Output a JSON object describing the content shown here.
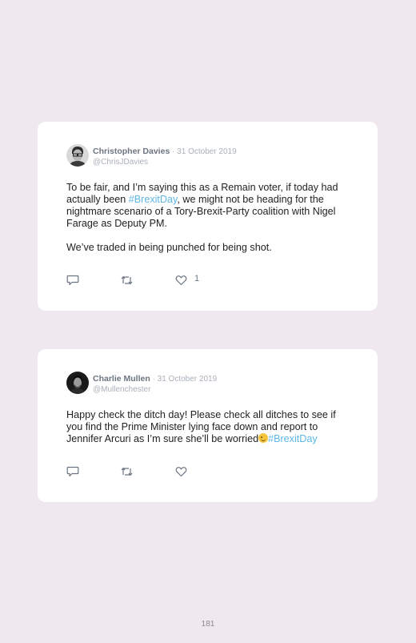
{
  "tweets": [
    {
      "author": "Christopher Davies",
      "date": " · 31 October 2019",
      "handle": "@ChrisJDavies",
      "text_1a": "To be fair, and I’m saying this as a Remain voter, if today had actually been ",
      "hashtag": "#BrexitDay",
      "text_1b": ", we might not be heading for the nightmare scenario of a Tory-Brexit-Party coalition with Nigel Farage as Deputy PM.",
      "text_2": "We’ve traded in being punched for being shot.",
      "like_count": "1"
    },
    {
      "author": "Charlie Mullen",
      "date": " · 31 October 2019",
      "handle": "@Mullenchester",
      "text_1a": "Happy check the ditch day! Please check all ditches to see if you find the Prime Minister lying face down and report to Jennifer Arcuri as I’m sure she’ll be worried",
      "hashtag": "#BrexitDay",
      "like_count": ""
    }
  ],
  "page_number": "181",
  "colors": {
    "background": "#efe8ee",
    "card": "#ffffff",
    "hashtag": "#5fb6e6",
    "meta": "#a9b0b8"
  },
  "icons": [
    "reply-icon",
    "retweet-icon",
    "heart-icon",
    "winking-face-icon"
  ]
}
